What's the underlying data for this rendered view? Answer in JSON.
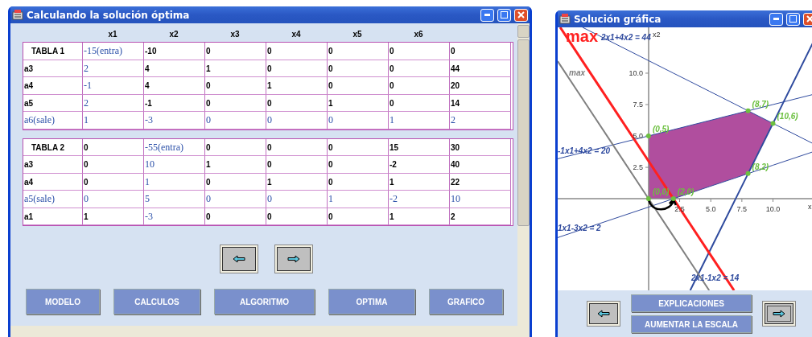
{
  "main_window": {
    "title": "Calculando la solución óptima",
    "column_headers": [
      "x1",
      "x2",
      "x3",
      "x4",
      "x5",
      "x6"
    ],
    "tables": [
      {
        "rows": [
          {
            "cells": [
              {
                "text": "TABLA 1",
                "highlight": false
              },
              {
                "text": "-15(entra)",
                "highlight": true
              },
              {
                "text": "-10",
                "highlight": false
              },
              {
                "text": "0",
                "highlight": false
              },
              {
                "text": "0",
                "highlight": false
              },
              {
                "text": "0",
                "highlight": false
              },
              {
                "text": "0",
                "highlight": false
              },
              {
                "text": "0",
                "highlight": false
              }
            ]
          },
          {
            "cells": [
              {
                "text": "a3",
                "highlight": false
              },
              {
                "text": "2",
                "highlight": true
              },
              {
                "text": "4",
                "highlight": false
              },
              {
                "text": "1",
                "highlight": false
              },
              {
                "text": "0",
                "highlight": false
              },
              {
                "text": "0",
                "highlight": false
              },
              {
                "text": "0",
                "highlight": false
              },
              {
                "text": "44",
                "highlight": false
              }
            ]
          },
          {
            "cells": [
              {
                "text": "a4",
                "highlight": false
              },
              {
                "text": "-1",
                "highlight": true
              },
              {
                "text": "4",
                "highlight": false
              },
              {
                "text": "0",
                "highlight": false
              },
              {
                "text": "1",
                "highlight": false
              },
              {
                "text": "0",
                "highlight": false
              },
              {
                "text": "0",
                "highlight": false
              },
              {
                "text": "20",
                "highlight": false
              }
            ]
          },
          {
            "cells": [
              {
                "text": "a5",
                "highlight": false
              },
              {
                "text": "2",
                "highlight": true
              },
              {
                "text": "-1",
                "highlight": false
              },
              {
                "text": "0",
                "highlight": false
              },
              {
                "text": "0",
                "highlight": false
              },
              {
                "text": "1",
                "highlight": false
              },
              {
                "text": "0",
                "highlight": false
              },
              {
                "text": "14",
                "highlight": false
              }
            ]
          },
          {
            "cells": [
              {
                "text": "a6(sale)",
                "highlight": true
              },
              {
                "text": "1",
                "highlight": true
              },
              {
                "text": "-3",
                "highlight": true
              },
              {
                "text": "0",
                "highlight": true
              },
              {
                "text": "0",
                "highlight": true
              },
              {
                "text": "0",
                "highlight": true
              },
              {
                "text": "1",
                "highlight": true
              },
              {
                "text": "2",
                "highlight": true
              }
            ]
          }
        ]
      },
      {
        "rows": [
          {
            "cells": [
              {
                "text": "TABLA 2",
                "highlight": false
              },
              {
                "text": "0",
                "highlight": false
              },
              {
                "text": "-55(entra)",
                "highlight": true
              },
              {
                "text": "0",
                "highlight": false
              },
              {
                "text": "0",
                "highlight": false
              },
              {
                "text": "0",
                "highlight": false
              },
              {
                "text": "15",
                "highlight": false
              },
              {
                "text": "30",
                "highlight": false
              }
            ]
          },
          {
            "cells": [
              {
                "text": "a3",
                "highlight": false
              },
              {
                "text": "0",
                "highlight": false
              },
              {
                "text": "10",
                "highlight": true
              },
              {
                "text": "1",
                "highlight": false
              },
              {
                "text": "0",
                "highlight": false
              },
              {
                "text": "0",
                "highlight": false
              },
              {
                "text": "-2",
                "highlight": false
              },
              {
                "text": "40",
                "highlight": false
              }
            ]
          },
          {
            "cells": [
              {
                "text": "a4",
                "highlight": false
              },
              {
                "text": "0",
                "highlight": false
              },
              {
                "text": "1",
                "highlight": true
              },
              {
                "text": "0",
                "highlight": false
              },
              {
                "text": "1",
                "highlight": false
              },
              {
                "text": "0",
                "highlight": false
              },
              {
                "text": "1",
                "highlight": false
              },
              {
                "text": "22",
                "highlight": false
              }
            ]
          },
          {
            "cells": [
              {
                "text": "a5(sale)",
                "highlight": true
              },
              {
                "text": "0",
                "highlight": true
              },
              {
                "text": "5",
                "highlight": true
              },
              {
                "text": "0",
                "highlight": true
              },
              {
                "text": "0",
                "highlight": true
              },
              {
                "text": "1",
                "highlight": true
              },
              {
                "text": "-2",
                "highlight": true
              },
              {
                "text": "10",
                "highlight": true
              }
            ]
          },
          {
            "cells": [
              {
                "text": "a1",
                "highlight": false
              },
              {
                "text": "1",
                "highlight": false
              },
              {
                "text": "-3",
                "highlight": true
              },
              {
                "text": "0",
                "highlight": false
              },
              {
                "text": "0",
                "highlight": false
              },
              {
                "text": "0",
                "highlight": false
              },
              {
                "text": "1",
                "highlight": false
              },
              {
                "text": "2",
                "highlight": false
              }
            ]
          }
        ]
      }
    ],
    "nav_buttons": [
      {
        "focused": false
      },
      {
        "focused": false
      }
    ],
    "buttons": [
      "MODELO",
      "CALCULOS",
      "ALGORITMO",
      "OPTIMA",
      "GRAFICO"
    ]
  },
  "graph_window": {
    "title": "Solución gráfica",
    "chart_data": {
      "type": "line",
      "xlabel": "x",
      "ylabel": "x2",
      "x": [
        -7.3,
        -7.1,
        -5.3,
        0,
        2,
        3.35,
        4.87,
        6.87,
        8,
        10,
        13.2
      ],
      "xlim": [
        -7.3,
        13.2
      ],
      "ylim": [
        -7.3,
        13.65
      ],
      "xticks": [
        {
          "value": 2.5,
          "label": "2.5"
        },
        {
          "value": 5,
          "label": "5.0"
        },
        {
          "value": 7.5,
          "label": "7.5"
        },
        {
          "value": 10,
          "label": "10.0"
        }
      ],
      "yticks": [
        {
          "value": 2.5,
          "label": "2.5"
        },
        {
          "value": 5,
          "label": "5.0"
        },
        {
          "value": 7.5,
          "label": "7.5"
        },
        {
          "value": 10,
          "label": "10.0"
        }
      ],
      "series": [
        {
          "name": "2x1+4x2 = 44",
          "color": "#2f4a9e",
          "values": [
            null,
            null,
            13.65,
            11,
            10,
            9.33,
            8.57,
            7.57,
            7,
            6,
            4.4
          ]
        },
        {
          "name": "-1x1+4x2 = 20",
          "color": "#2e4a9f",
          "values": [
            3.18,
            3.23,
            3.68,
            5,
            5.5,
            5.84,
            6.22,
            6.72,
            7,
            7.5,
            8.3
          ]
        },
        {
          "name": "1x1-3x2 = 2",
          "color": "#304a9d",
          "values": [
            -3.1,
            -3.03,
            -2.43,
            -0.67,
            0,
            0.45,
            0.96,
            1.62,
            2,
            2.67,
            3.73
          ]
        },
        {
          "name": "2x1-1x2 = 14",
          "color": "#2f4b9e",
          "values": [
            null,
            null,
            null,
            null,
            null,
            -7.3,
            -4.26,
            -0.26,
            2,
            6,
            12.4
          ]
        },
        {
          "name": "max",
          "color": "#ff2020",
          "values": [
            null,
            13.65,
            10.95,
            3,
            0,
            -2.03,
            -4.31,
            -7.3,
            null,
            null,
            null
          ]
        },
        {
          "name": "max",
          "color": "#808080",
          "values": [
            10.95,
            10.65,
            7.95,
            0,
            -3,
            -5.03,
            -7.3,
            null,
            null,
            null,
            null
          ]
        }
      ],
      "annotations": [
        {
          "x": 0,
          "y": 0,
          "text": "(0,0)"
        },
        {
          "x": 2,
          "y": 0,
          "text": "(2,0)"
        },
        {
          "x": 8,
          "y": 2,
          "text": "(8,2)"
        },
        {
          "x": 10,
          "y": 6,
          "text": "(10,6)"
        },
        {
          "x": 8,
          "y": 7,
          "text": "(8,7)"
        },
        {
          "x": 0,
          "y": 5,
          "text": "(0,5)"
        }
      ]
    },
    "nav_buttons": [
      {
        "focused": false
      },
      {
        "focused": true
      }
    ],
    "buttons": [
      "EXPLICACIONES",
      "AUMENTAR LA ESCALA"
    ]
  }
}
